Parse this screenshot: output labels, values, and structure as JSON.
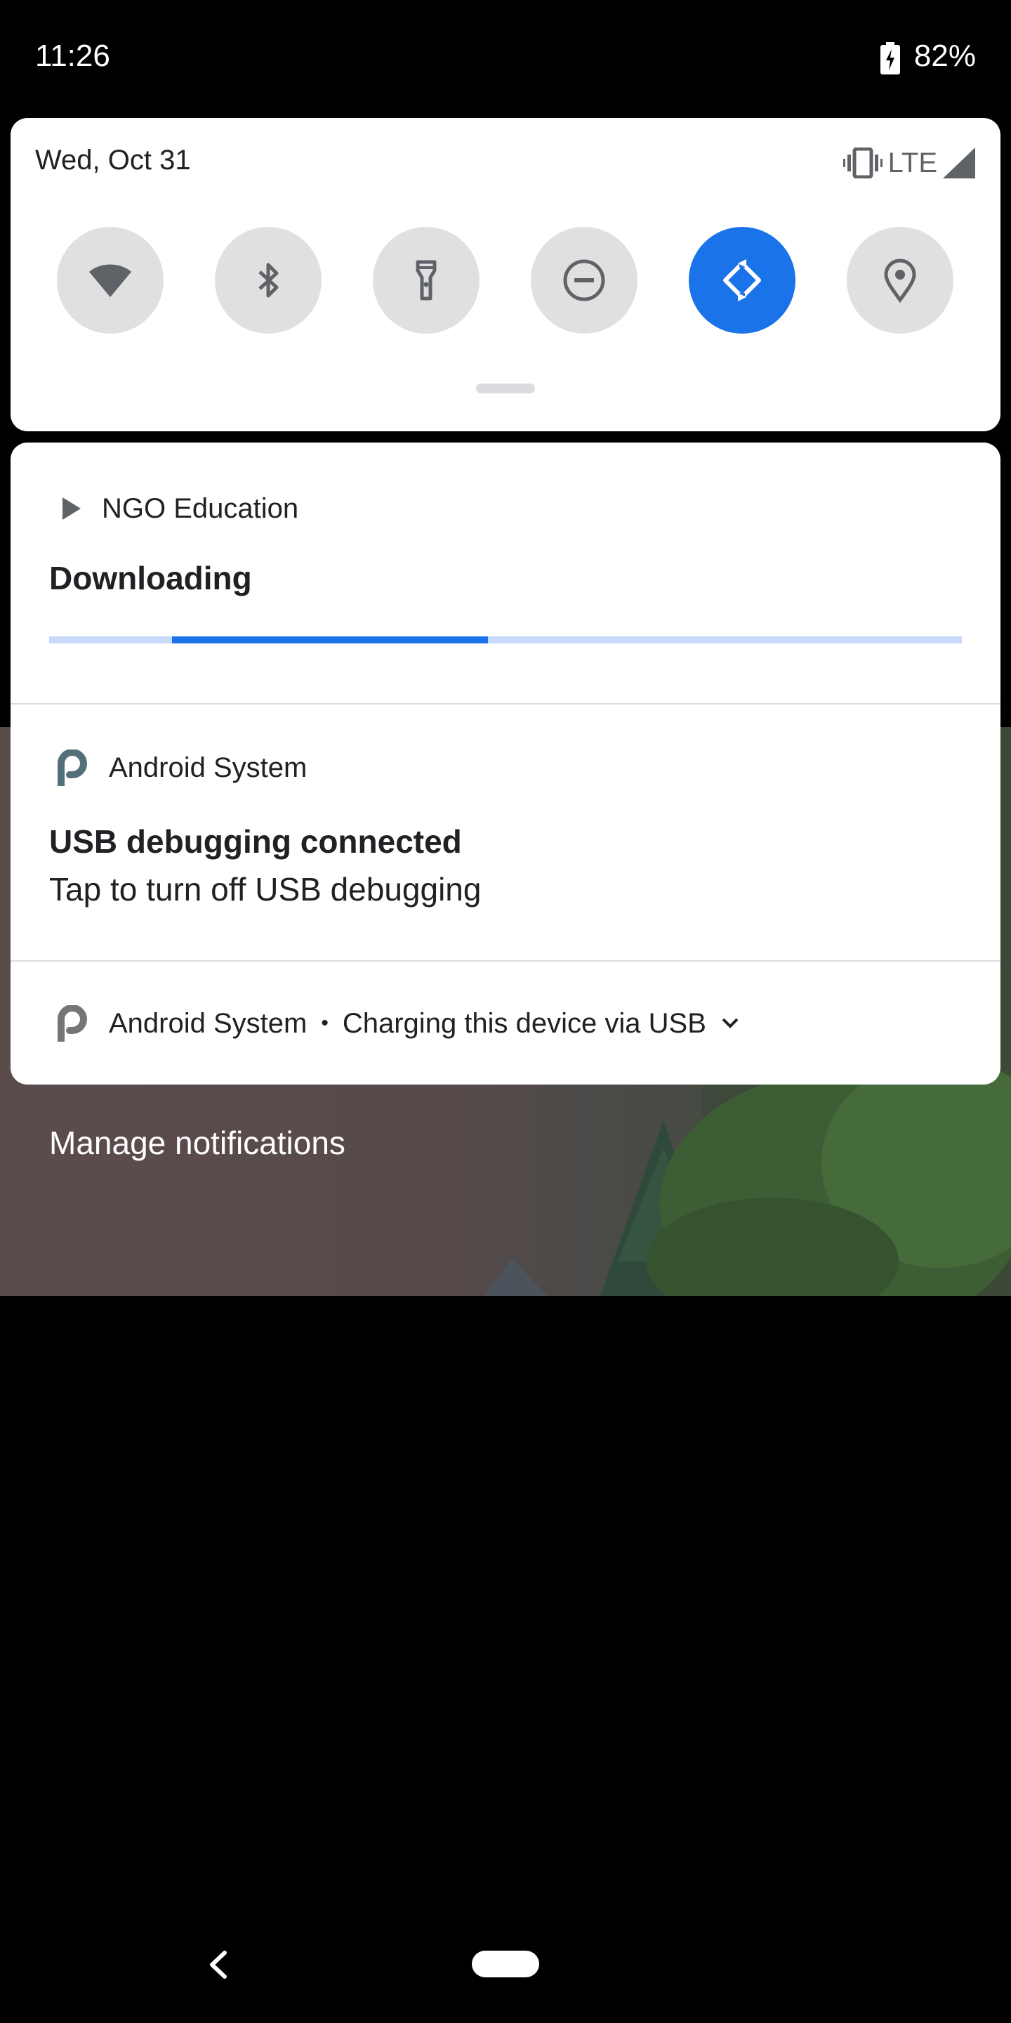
{
  "status_bar": {
    "time": "11:26",
    "battery_percent": "82%"
  },
  "quick_settings": {
    "date": "Wed, Oct 31",
    "network_type": "LTE",
    "tiles": [
      {
        "name": "wifi-icon",
        "active": false
      },
      {
        "name": "bluetooth-icon",
        "active": false
      },
      {
        "name": "flashlight-icon",
        "active": false
      },
      {
        "name": "do-not-disturb-icon",
        "active": false
      },
      {
        "name": "auto-rotate-icon",
        "active": true
      },
      {
        "name": "location-icon",
        "active": false
      }
    ],
    "accent_color": "#1a73e8"
  },
  "notifications": [
    {
      "app": "NGO Education",
      "app_icon": "play-icon",
      "title": "Downloading",
      "progress": {
        "indeterminate": true
      }
    },
    {
      "app": "Android System",
      "app_icon": "android-p-icon",
      "title": "USB debugging connected",
      "text": "Tap to turn off USB debugging"
    },
    {
      "app": "Android System",
      "app_icon": "android-p-icon",
      "separator": "•",
      "summary": "Charging this device via USB",
      "expand_icon": "chevron-down-icon"
    }
  ],
  "manage_notifications_label": "Manage notifications",
  "nav_bar": {
    "back_icon": "back-icon",
    "home_icon": "home-pill-icon"
  }
}
